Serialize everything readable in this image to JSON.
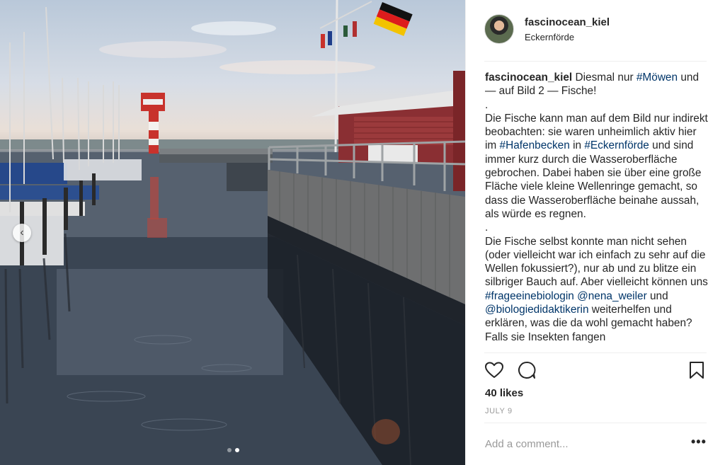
{
  "post": {
    "username": "fascinocean_kiel",
    "location": "Eckernförde",
    "caption": {
      "username": "fascinocean_kiel",
      "line1_a": " Diesmal nur ",
      "tag_moewen": "#Möwen",
      "line1_b": " und — auf Bild 2 — Fische!",
      "dot1": ".",
      "para1_a": "Die Fische kann man auf dem Bild nur indirekt beobachten: sie waren unheimlich aktiv hier im ",
      "tag_hafenbecken": "#Hafenbecken",
      "para1_b": " in ",
      "tag_eckernfoerde": "#Eckernförde",
      "para1_c": " und sind immer kurz durch die Wasseroberfläche gebrochen. Dabei haben sie über eine große Fläche viele kleine Wellenringe gemacht, so dass die Wasseroberfläche beinahe aussah, als würde es regnen.",
      "dot2": ".",
      "para2_a": "Die Fische selbst konnte man nicht sehen (oder vielleicht war ich einfach zu sehr auf die Wellen fokussiert?), nur ab und zu blitze ein silbriger Bauch auf. Aber vielleicht können uns ",
      "tag_frage": "#frageeinebiologin",
      "para2_b": " ",
      "mention_nena": "@nena_weiler",
      "para2_c": " und ",
      "mention_bio": "@biologiedidaktikerin",
      "para2_d": " weiterhelfen und erklären, was die da wohl gemacht haben? Falls sie Insekten fangen"
    },
    "likes": "40 likes",
    "date": "JULY 9",
    "comment_placeholder": "Add a comment...",
    "more_label": "•••"
  },
  "carousel": {
    "prev_label": "‹",
    "total_slides": 2,
    "active_slide": 2
  },
  "icons": {
    "like": "heart-icon",
    "comment": "comment-bubble-icon",
    "save": "bookmark-icon",
    "prev": "chevron-left-icon",
    "avatar": "avatar"
  },
  "colors": {
    "hashtag": "#003569",
    "text": "#262626",
    "muted": "#999999",
    "border": "#efefef"
  }
}
